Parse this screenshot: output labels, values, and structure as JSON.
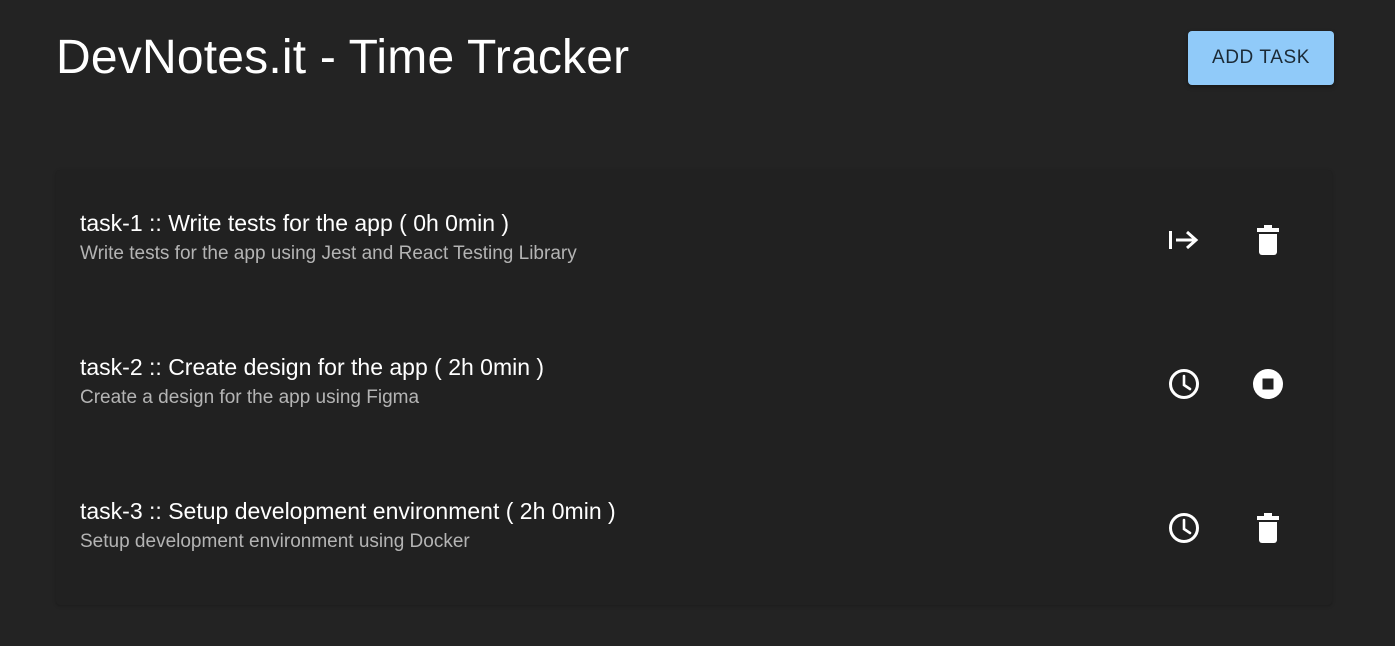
{
  "app": {
    "title": "DevNotes.it - Time Tracker",
    "add_task_label": "ADD TASK",
    "accent_color": "#90caf9"
  },
  "tasks": [
    {
      "title": "task-1 :: Write tests for the app ( 0h 0min )",
      "description": "Write tests for the app using Jest and React Testing Library",
      "primary_action_icon": "start-arrow-icon",
      "secondary_action_icon": "trash-icon"
    },
    {
      "title": "task-2 :: Create design for the app ( 2h 0min )",
      "description": "Create a design for the app using Figma",
      "primary_action_icon": "clock-icon",
      "secondary_action_icon": "stop-circle-icon"
    },
    {
      "title": "task-3 :: Setup development environment ( 2h 0min )",
      "description": "Setup development environment using Docker",
      "primary_action_icon": "clock-icon",
      "secondary_action_icon": "trash-icon"
    }
  ]
}
